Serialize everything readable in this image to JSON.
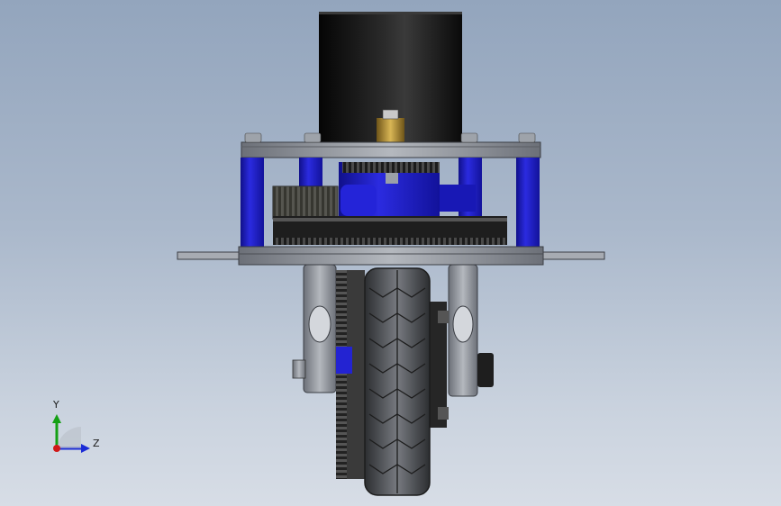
{
  "viewport": {
    "background_top": "#93a5bd",
    "background_bottom": "#d7dde6"
  },
  "model": {
    "colors": {
      "motor": "#111111",
      "standoff_blue": "#1f1fc8",
      "plate": "#9a9ea6",
      "bracket": "#8d929a",
      "tire": "#5a5d62",
      "gear_dark": "#1c1c1c",
      "brass": "#b9953a"
    }
  },
  "triad": {
    "y_label": "Y",
    "z_label": "Z",
    "y_color": "#14a014",
    "z_color": "#1a2bd6",
    "origin_color": "#d01818"
  }
}
